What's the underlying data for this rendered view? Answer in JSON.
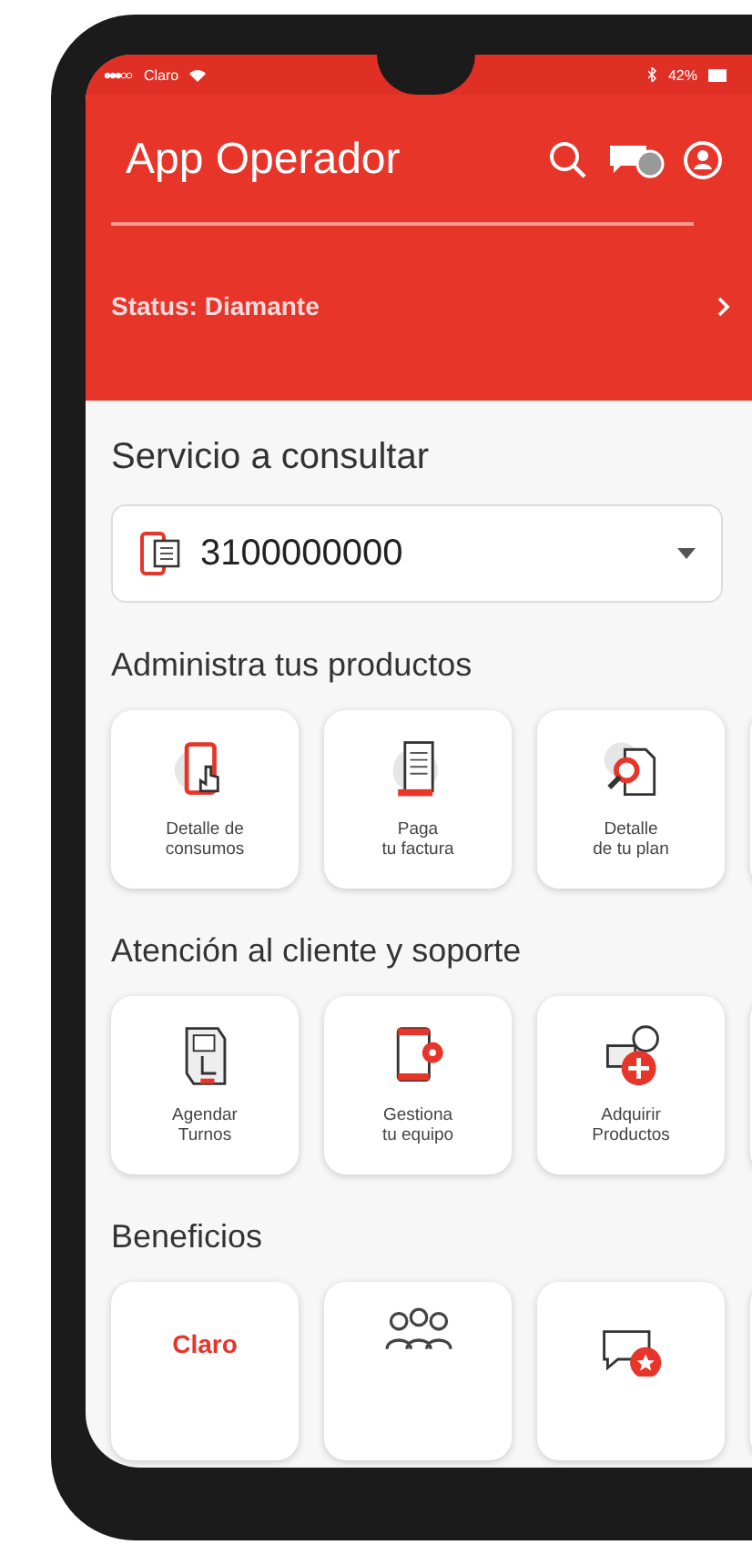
{
  "status_bar": {
    "carrier": "Claro",
    "battery": "42%"
  },
  "header": {
    "title": "App Operador",
    "status": "Status: Diamante"
  },
  "service": {
    "label": "Servicio a consultar",
    "number": "3100000000"
  },
  "sections": [
    {
      "title": "Administra tus productos",
      "tiles": [
        {
          "kind": "phone-touch",
          "lines": [
            "Detalle de",
            "consumos"
          ]
        },
        {
          "kind": "receipt",
          "lines": [
            "Paga",
            "tu factura"
          ]
        },
        {
          "kind": "doc-search",
          "lines": [
            "Detalle",
            "de tu plan"
          ]
        }
      ]
    },
    {
      "title": "Atención al cliente y soporte",
      "tiles": [
        {
          "kind": "kiosk",
          "lines": [
            "Agendar",
            "Turnos"
          ]
        },
        {
          "kind": "phone-gear",
          "lines": [
            "Gestiona",
            "tu equipo"
          ]
        },
        {
          "kind": "cart-plus",
          "lines": [
            "Adquirir",
            "Productos"
          ]
        }
      ]
    },
    {
      "title": "Beneficios",
      "tiles": [
        {
          "kind": "logo",
          "logo": "Claro"
        },
        {
          "kind": "people"
        },
        {
          "kind": "chat-star"
        }
      ]
    }
  ]
}
